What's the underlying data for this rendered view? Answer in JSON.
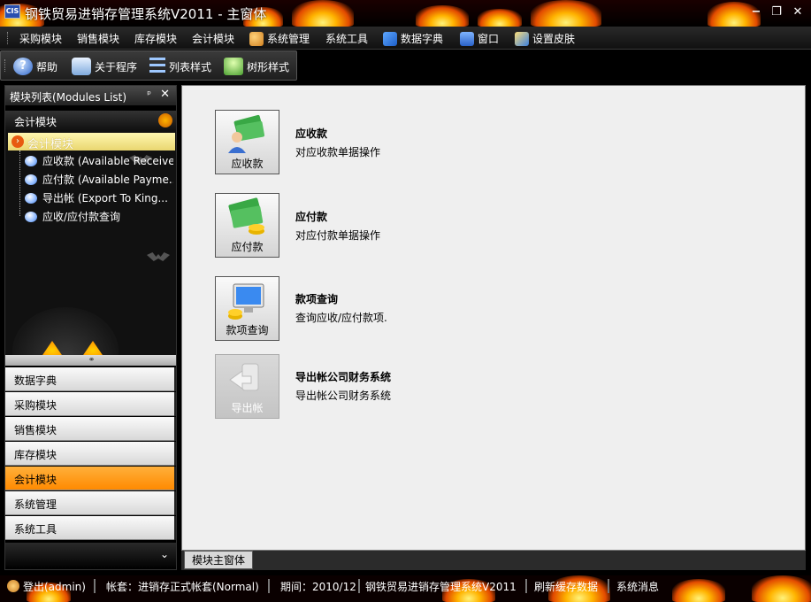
{
  "window": {
    "logo_text": "CIS",
    "title": "钢铁贸易进销存管理系统V2011 - 主窗体",
    "minimize": "−",
    "restore": "❐",
    "close": "✕"
  },
  "menu": [
    {
      "label": "采购模块"
    },
    {
      "label": "销售模块"
    },
    {
      "label": "库存模块"
    },
    {
      "label": "会计模块"
    },
    {
      "label": "系统管理",
      "icon": "users-icon"
    },
    {
      "label": "系统工具"
    },
    {
      "label": "数据字典",
      "icon": "network-icon"
    },
    {
      "label": "窗口",
      "icon": "window-icon"
    },
    {
      "label": "设置皮肤",
      "icon": "skin-icon"
    }
  ],
  "toolbar": [
    {
      "label": "帮助",
      "icon": "help-icon"
    },
    {
      "label": "关于程序",
      "icon": "about-icon"
    },
    {
      "label": "列表样式",
      "icon": "list-style-icon"
    },
    {
      "label": "树形样式",
      "icon": "tree-style-icon"
    }
  ],
  "left_panel": {
    "header": "模块列表(Modules List)",
    "pin": "ᵖ",
    "close": "✕",
    "tree_title": "会计模块",
    "tree_root": "会计模块",
    "tree_items": [
      "应收款 (Available Receive)",
      "应付款 (Available Payme...",
      "导出帐 (Export To King...",
      "应收/应付款查询"
    ],
    "splitter_glyph": "⚭",
    "nav_buttons": [
      "数据字典",
      "采购模块",
      "销售模块",
      "库存模块",
      "会计模块",
      "系统管理",
      "系统工具"
    ],
    "active_nav": "会计模块",
    "more_glyph": "⌄"
  },
  "main_items": [
    {
      "tile_label": "应收款",
      "title": "应收款",
      "desc": "对应收款单据操作",
      "icon": "receivable-icon",
      "enabled": true
    },
    {
      "tile_label": "应付款",
      "title": "应付款",
      "desc": "对应付款单据操作",
      "icon": "payable-icon",
      "enabled": true
    },
    {
      "tile_label": "款项查询",
      "title": "款项查询",
      "desc": "查询应收/应付款项.",
      "icon": "query-icon",
      "enabled": true
    },
    {
      "tile_label": "导出帐",
      "title": "导出帐公司财务系统",
      "desc": "导出帐公司财务系统",
      "icon": "export-icon",
      "enabled": false
    }
  ],
  "document_tab": "模块主窗体",
  "status_bar": {
    "login": "登出(admin)",
    "account": "帐套：进销存正式帐套(Normal)",
    "period": "期间：2010/12",
    "system": "钢铁贸易进销存管理系统V2011",
    "refresh": "刷新缓存数据",
    "messages": "系统消息"
  }
}
